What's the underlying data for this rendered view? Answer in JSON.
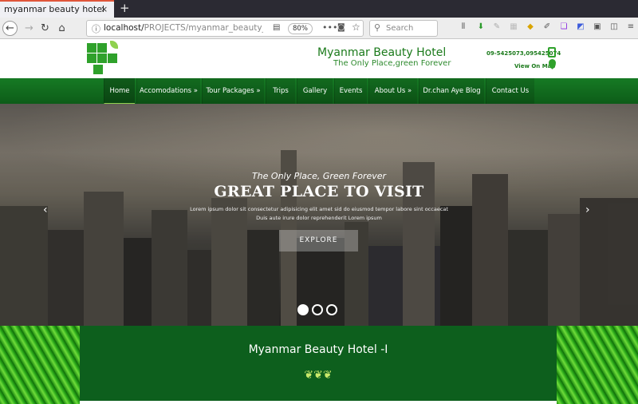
{
  "browser": {
    "tab_title": "myanmar beauty hotel",
    "tab_close": "×",
    "new_tab": "+",
    "url_host": "localhost/",
    "url_path": "PROJECTS/myanmar_beauty_up",
    "zoom": "80%",
    "search_placeholder": "Search",
    "nav": {
      "back": "←",
      "forward": "→",
      "reload": "↻",
      "home": "⌂"
    }
  },
  "header": {
    "title": "Myanmar Beauty Hotel",
    "tagline": "The Only Place,green Forever",
    "phone": "09-5425073,095425074",
    "map_link": "View On Map"
  },
  "menu": [
    {
      "label": "Home"
    },
    {
      "label": "Accomodations »"
    },
    {
      "label": "Tour Packages »"
    },
    {
      "label": "Trips"
    },
    {
      "label": "Gallery"
    },
    {
      "label": "Events"
    },
    {
      "label": "About Us »"
    },
    {
      "label": "Dr.chan Aye Blog"
    },
    {
      "label": "Contact Us"
    }
  ],
  "hero": {
    "subtitle": "The Only Place, Green Forever",
    "title": "GREAT PLACE TO VISIT",
    "text_line1": "Lorem ipsum dolor sit consectetur adipisicing elit amet sid do eiusmod tempor labore sint occaecat",
    "text_line2": "Duis aute irure dolor reprehenderit Lorem ipsum",
    "button": "EXPLORE",
    "prev": "‹",
    "next": "›",
    "active_slide": 1,
    "slide_count": 3
  },
  "section": {
    "title": "Myanmar Beauty Hotel -I",
    "ornament": "❦❦❦"
  },
  "colors": {
    "brand_green": "#1b7a1b",
    "menu_green": "#167a24",
    "section_green": "#0d5f1d"
  }
}
